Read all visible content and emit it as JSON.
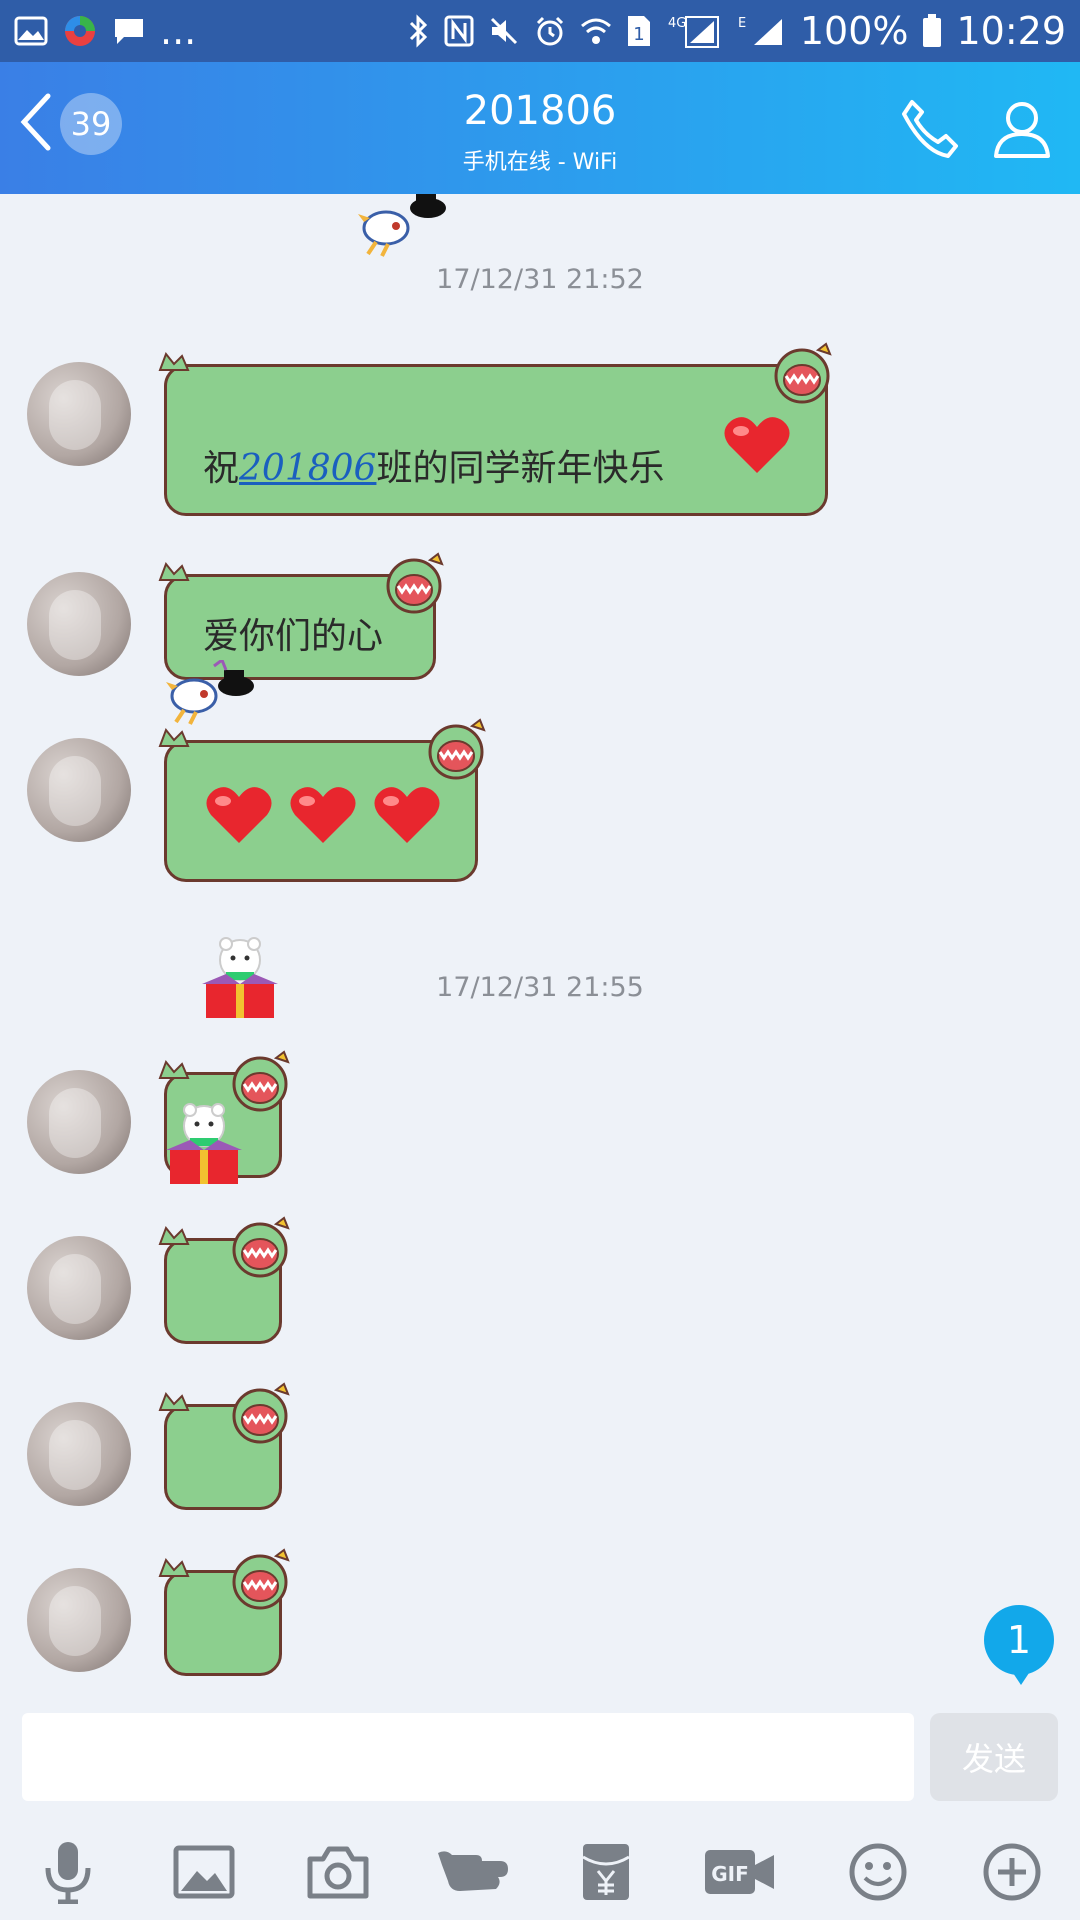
{
  "status_bar": {
    "left_icons": [
      "gallery-icon",
      "app-icon",
      "chat-icon"
    ],
    "more": "...",
    "battery": "100%",
    "time": "10:29",
    "network": "4G",
    "network2": "E",
    "sim": "1"
  },
  "header": {
    "back_badge": "39",
    "title": "201806",
    "subtitle": "手机在线 - WiFi"
  },
  "timestamps": [
    "17/12/31 21:52",
    "17/12/31 21:55"
  ],
  "messages": {
    "m1": {
      "prefix": "祝",
      "link": "201806",
      "suffix": "班的同学新年快乐"
    },
    "m2": {
      "text": "爱你们的心"
    }
  },
  "unread_count": "1",
  "input": {
    "placeholder": "",
    "send_label": "发送"
  },
  "toolbar": [
    "microphone-icon",
    "image-icon",
    "camera-icon",
    "poke-icon",
    "red-packet-icon",
    "gif-icon",
    "emoji-icon",
    "plus-icon"
  ],
  "colors": {
    "header_start": "#3a7fe6",
    "header_end": "#20b8f4",
    "bubble": "#8ccf8e",
    "badge": "#12a8ea"
  }
}
